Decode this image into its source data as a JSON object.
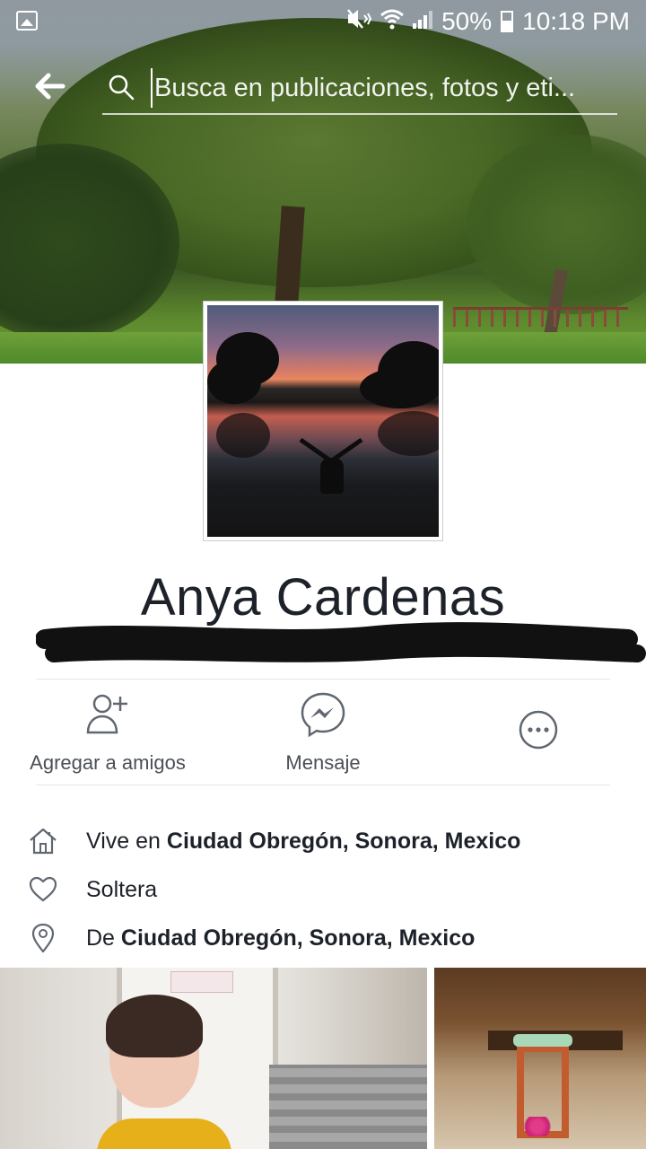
{
  "status_bar": {
    "battery_percent": "50%",
    "time": "10:18 PM",
    "icons": [
      "gallery-icon",
      "mute-vibrate-icon",
      "wifi-icon",
      "signal-icon",
      "battery-icon"
    ]
  },
  "search": {
    "placeholder": "Busca en publicaciones, fotos y eti..."
  },
  "profile": {
    "name": "Anya Cardenas"
  },
  "actions": {
    "add_friend_label": "Agregar a amigos",
    "message_label": "Mensaje",
    "more_icon": "more-icon"
  },
  "info": {
    "lives_prefix": "Vive en ",
    "lives_place": "Ciudad Obregón, Sonora, Mexico",
    "relationship": "Soltera",
    "from_prefix": "De ",
    "from_place": "Ciudad Obregón, Sonora, Mexico"
  },
  "colors": {
    "icon_gray": "#606770",
    "text_dark": "#1d2129",
    "divider": "#e4e6eb"
  }
}
